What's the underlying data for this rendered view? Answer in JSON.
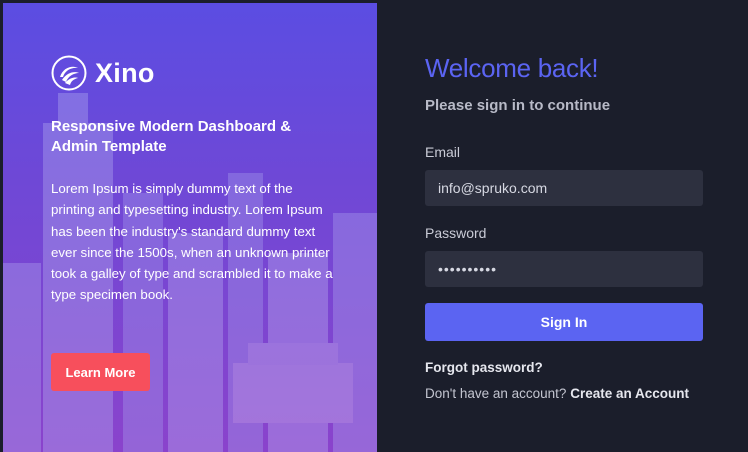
{
  "brand": {
    "name": "Xino",
    "logo_icon": "xino-swirl-logo-icon"
  },
  "hero": {
    "heading": "Responsive Modern Dashboard & Admin Template",
    "description": "Lorem Ipsum is simply dummy text of the printing and typesetting industry. Lorem Ipsum has been the industry's standard dummy text ever since the 1500s, when an unknown printer took a galley of type and scrambled it to make a type specimen book.",
    "learn_more_label": "Learn More"
  },
  "login": {
    "title": "Welcome back!",
    "subtitle": "Please sign in to continue",
    "email_label": "Email",
    "email_value": "info@spruko.com",
    "password_label": "Password",
    "password_value": "••••••••••",
    "sign_in_label": "Sign In",
    "forgot_password": "Forgot password?",
    "no_account_text": "Don't have an account?",
    "create_account": "Create an Account"
  },
  "colors": {
    "accent": "#5b64f2",
    "learn_more": "#f74f5c",
    "panel_dark": "#1b1e2b",
    "input_bg": "#2d303f"
  }
}
